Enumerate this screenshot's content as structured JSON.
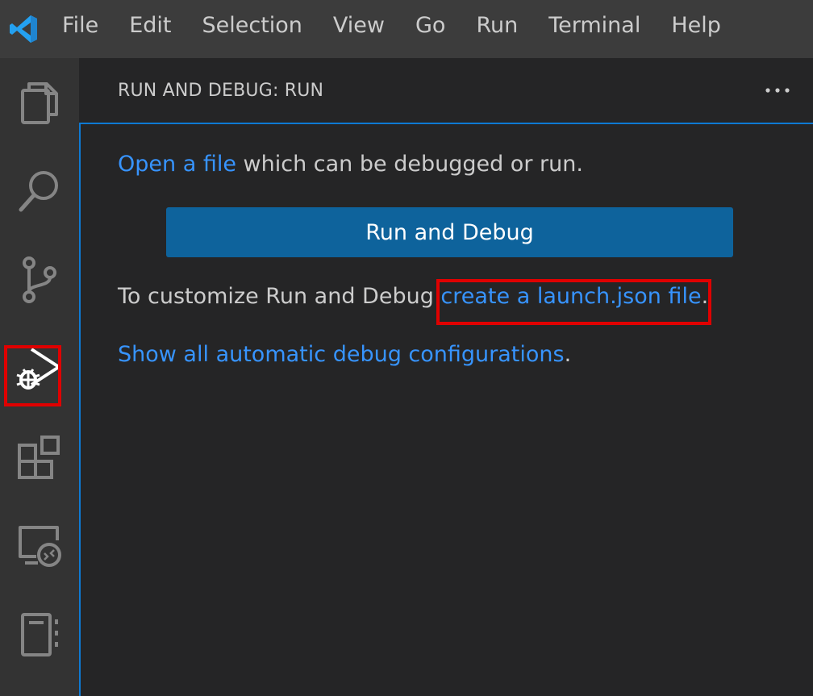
{
  "menubar": {
    "logo": "vscode-logo",
    "items": [
      "File",
      "Edit",
      "Selection",
      "View",
      "Go",
      "Run",
      "Terminal",
      "Help"
    ]
  },
  "activitybar": {
    "items": [
      {
        "name": "explorer",
        "icon": "files-icon"
      },
      {
        "name": "search",
        "icon": "search-icon"
      },
      {
        "name": "source-control",
        "icon": "source-control-icon"
      },
      {
        "name": "run-and-debug",
        "icon": "run-debug-icon",
        "active": true
      },
      {
        "name": "extensions",
        "icon": "extensions-icon"
      },
      {
        "name": "remote-explorer",
        "icon": "remote-explorer-icon"
      },
      {
        "name": "notebook",
        "icon": "notebook-icon"
      }
    ]
  },
  "sidebar": {
    "title": "RUN AND DEBUG: RUN",
    "more_actions": "...",
    "open_file_link": "Open a file",
    "open_file_suffix": " which can be debugged or run.",
    "run_button_label": "Run and Debug",
    "customize_prefix": "To customize Run and Debug ",
    "launch_json_link": "create a launch.json file",
    "customize_suffix": ".",
    "show_all_link": "Show all automatic debug configurations",
    "show_all_suffix": "."
  },
  "colors": {
    "menubar_bg": "#3c3c3c",
    "activitybar_bg": "#333333",
    "sidebar_bg": "#252526",
    "link": "#3794ff",
    "button_bg": "#0e639c",
    "focus_border": "#0e7ad3",
    "highlight": "#e00000"
  }
}
